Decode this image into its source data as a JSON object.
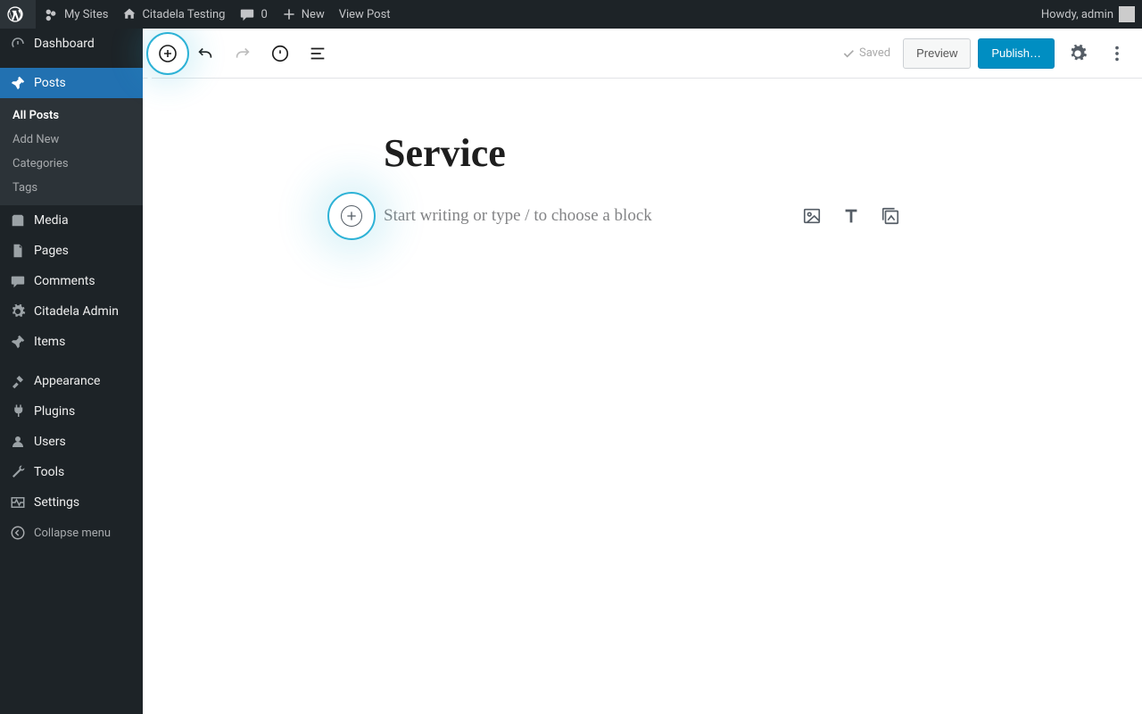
{
  "adminbar": {
    "my_sites": "My Sites",
    "site_name": "Citadela Testing",
    "comments_count": "0",
    "new_label": "New",
    "view_post": "View Post",
    "howdy": "Howdy, admin"
  },
  "menu": {
    "dashboard": "Dashboard",
    "posts": "Posts",
    "posts_sub": {
      "all": "All Posts",
      "add_new": "Add New",
      "categories": "Categories",
      "tags": "Tags"
    },
    "media": "Media",
    "pages": "Pages",
    "comments": "Comments",
    "citadela_admin": "Citadela Admin",
    "items": "Items",
    "appearance": "Appearance",
    "plugins": "Plugins",
    "users": "Users",
    "tools": "Tools",
    "settings": "Settings",
    "collapse": "Collapse menu"
  },
  "editor": {
    "saved": "Saved",
    "preview": "Preview",
    "publish": "Publish…",
    "title": "Service",
    "prompt": "Start writing or type / to choose a block"
  }
}
